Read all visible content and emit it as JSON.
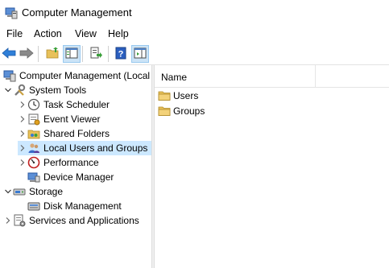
{
  "window": {
    "title": "Computer Management",
    "app_icon": "computer-management-icon"
  },
  "menu": [
    {
      "label": "File"
    },
    {
      "label": "Action"
    },
    {
      "label": "View"
    },
    {
      "label": "Help"
    }
  ],
  "toolbar": {
    "buttons": [
      {
        "icon": "back-arrow-icon"
      },
      {
        "icon": "forward-arrow-icon"
      },
      {
        "icon": "up-folder-icon"
      },
      {
        "icon": "show-hide-console-tree-icon",
        "active": true
      },
      {
        "icon": "export-list-icon"
      },
      {
        "icon": "help-icon"
      },
      {
        "icon": "show-hide-action-pane-icon",
        "active": true
      }
    ]
  },
  "tree": {
    "items": [
      {
        "label": "Computer Management (Local",
        "icon": "computer-management-icon",
        "expander": "none"
      },
      {
        "label": "System Tools",
        "icon": "tools-icon",
        "expander": "expanded"
      },
      {
        "label": "Task Scheduler",
        "icon": "clock-icon",
        "expander": "collapsed"
      },
      {
        "label": "Event Viewer",
        "icon": "event-viewer-icon",
        "expander": "collapsed"
      },
      {
        "label": "Shared Folders",
        "icon": "shared-folder-icon",
        "expander": "collapsed"
      },
      {
        "label": "Local Users and Groups",
        "icon": "users-icon",
        "expander": "collapsed",
        "selected": true
      },
      {
        "label": "Performance",
        "icon": "performance-icon",
        "expander": "collapsed"
      },
      {
        "label": "Device Manager",
        "icon": "device-manager-icon",
        "expander": "none"
      },
      {
        "label": "Storage",
        "icon": "storage-icon",
        "expander": "expanded"
      },
      {
        "label": "Disk Management",
        "icon": "disk-icon",
        "expander": "none"
      },
      {
        "label": "Services and Applications",
        "icon": "services-icon",
        "expander": "collapsed"
      }
    ]
  },
  "list": {
    "columns": [
      {
        "label": "Name"
      }
    ],
    "rows": [
      {
        "name": "Users",
        "icon": "folder-icon"
      },
      {
        "name": "Groups",
        "icon": "folder-icon"
      }
    ]
  },
  "colors": {
    "selection": "#cce8ff",
    "toolbar_active": "#cce4f7",
    "folder": "#e8c15a"
  }
}
